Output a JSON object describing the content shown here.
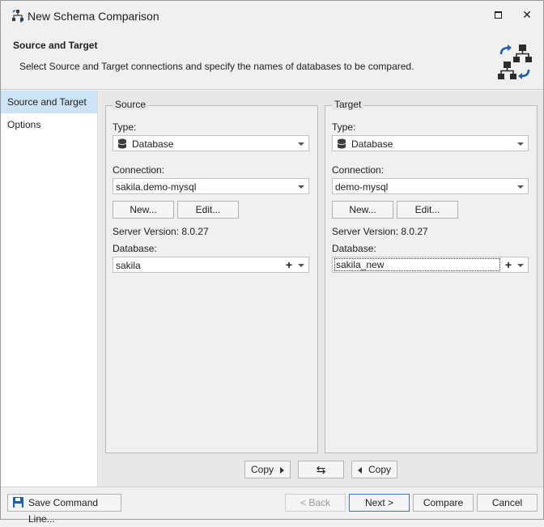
{
  "window": {
    "title": "New Schema Comparison",
    "close_glyph": "✕"
  },
  "header": {
    "title": "Source and Target",
    "description": "Select Source and Target connections and specify the names of databases to be compared."
  },
  "sidebar": {
    "items": [
      {
        "label": "Source and Target",
        "active": true
      },
      {
        "label": "Options",
        "active": false
      }
    ]
  },
  "source": {
    "legend": "Source",
    "type_label": "Type:",
    "type_value": "Database",
    "connection_label": "Connection:",
    "connection_value": "sakila.demo-mysql",
    "new_button": "New...",
    "edit_button": "Edit...",
    "server_version": "Server Version: 8.0.27",
    "database_label": "Database:",
    "database_value": "sakila",
    "add_glyph": "+"
  },
  "target": {
    "legend": "Target",
    "type_label": "Type:",
    "type_value": "Database",
    "connection_label": "Connection:",
    "connection_value": "demo-mysql",
    "new_button": "New...",
    "edit_button": "Edit...",
    "server_version": "Server Version: 8.0.27",
    "database_label": "Database:",
    "database_value": "sakila_new",
    "add_glyph": "+"
  },
  "copy_bar": {
    "copy_right": "Copy",
    "swap_glyph": "⇆",
    "copy_left": "Copy"
  },
  "footer": {
    "save_command_line": "Save Command Line...",
    "back": "< Back",
    "next": "Next >",
    "compare": "Compare",
    "cancel": "Cancel"
  },
  "icons": {
    "app": "schema-compare-icon",
    "header": "schema-sync-diagram-icon",
    "database": "database-icon",
    "save": "floppy-disk-icon"
  },
  "colors": {
    "accent": "#1f5fa8",
    "selection": "#cde4f7",
    "panel": "#f0f0f0"
  }
}
